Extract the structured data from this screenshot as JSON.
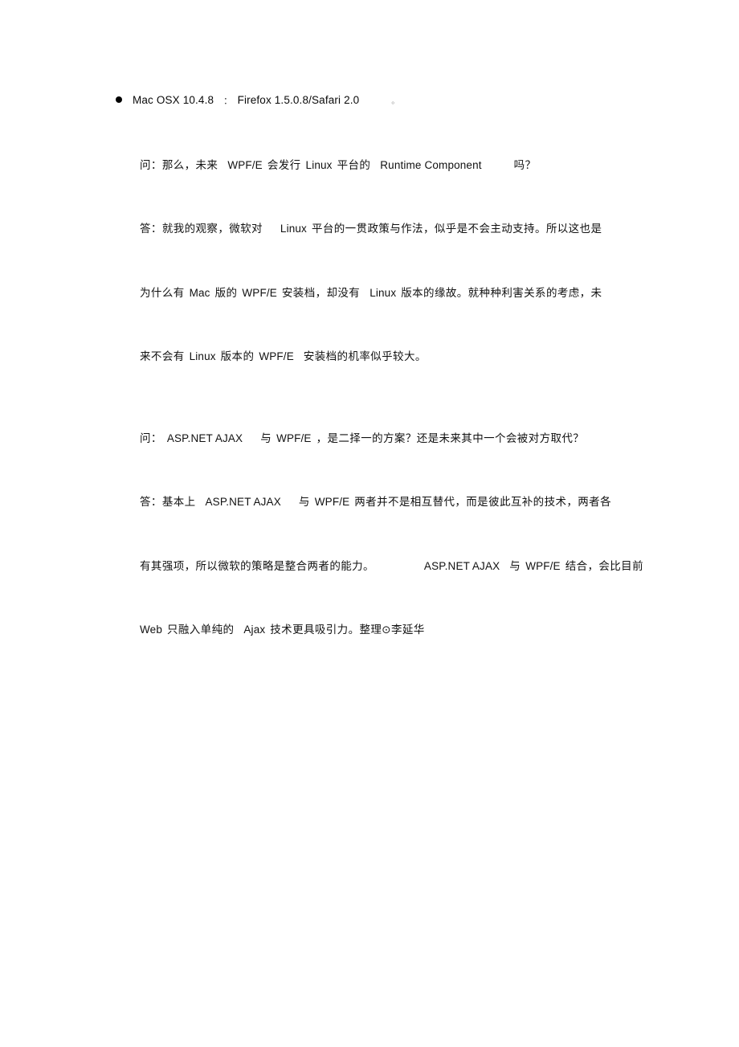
{
  "document": {
    "background_color": "#ffffff",
    "text_color": "#111111",
    "bullet": {
      "marker": "bullet-disc",
      "platform": "Mac OSX 10.4.8",
      "separator": "：",
      "browsers": "Firefox 1.5.0.8/Safari 2.0",
      "trailing_period": "。"
    },
    "qa_blocks": [
      {
        "question": {
          "prefix": "问：",
          "lines": [
            {
              "segments": [
                {
                  "type": "cjk",
                  "text": "问："
                },
                {
                  "type": "cjk",
                  "text": "那么，未来"
                },
                {
                  "type": "gap",
                  "size": "m"
                },
                {
                  "type": "latin",
                  "text": "WPF/E"
                },
                {
                  "type": "gap",
                  "size": "s"
                },
                {
                  "type": "cjk",
                  "text": "会发行"
                },
                {
                  "type": "gap",
                  "size": "s"
                },
                {
                  "type": "latin",
                  "text": "Linux"
                },
                {
                  "type": "gap",
                  "size": "s"
                },
                {
                  "type": "cjk",
                  "text": "平台的"
                },
                {
                  "type": "gap",
                  "size": "m"
                },
                {
                  "type": "latin",
                  "text": "Runtime Component"
                },
                {
                  "type": "gap",
                  "size": "xl"
                },
                {
                  "type": "cjk",
                  "text": "吗？"
                }
              ],
              "plain": "问：那么，未来 WPF/E 会发行 Linux 平台的 Runtime Component 吗？"
            }
          ]
        },
        "answer": {
          "prefix": "答：",
          "lines": [
            {
              "segments": [
                {
                  "type": "cjk",
                  "text": "答：就我的观察，微软对"
                },
                {
                  "type": "gap",
                  "size": "l"
                },
                {
                  "type": "latin",
                  "text": "Linux"
                },
                {
                  "type": "gap",
                  "size": "s"
                },
                {
                  "type": "cjk",
                  "text": "平台的一贯政策与作法，似乎是不会主动支持。所以这也是"
                }
              ],
              "plain": "答：就我的观察，微软对 Linux 平台的一贯政策与作法，似乎是不会主动支持。所以这也是"
            },
            {
              "segments": [
                {
                  "type": "cjk",
                  "text": "为什么有"
                },
                {
                  "type": "gap",
                  "size": "s"
                },
                {
                  "type": "latin",
                  "text": "Mac"
                },
                {
                  "type": "gap",
                  "size": "s"
                },
                {
                  "type": "cjk",
                  "text": "版的"
                },
                {
                  "type": "gap",
                  "size": "s"
                },
                {
                  "type": "latin",
                  "text": "WPF/E"
                },
                {
                  "type": "gap",
                  "size": "s"
                },
                {
                  "type": "cjk",
                  "text": "安装档，却没有"
                },
                {
                  "type": "gap",
                  "size": "m"
                },
                {
                  "type": "latin",
                  "text": "Linux"
                },
                {
                  "type": "gap",
                  "size": "s"
                },
                {
                  "type": "cjk",
                  "text": "版本的缘故。就种种利害关系的考虑，未"
                }
              ],
              "plain": "为什么有 Mac 版的 WPF/E 安装档，却没有 Linux 版本的缘故。就种种利害关系的考虑，未"
            },
            {
              "segments": [
                {
                  "type": "cjk",
                  "text": "来不会有"
                },
                {
                  "type": "gap",
                  "size": "s"
                },
                {
                  "type": "latin",
                  "text": "Linux"
                },
                {
                  "type": "gap",
                  "size": "s"
                },
                {
                  "type": "cjk",
                  "text": "版本的"
                },
                {
                  "type": "gap",
                  "size": "s"
                },
                {
                  "type": "latin",
                  "text": "WPF/E"
                },
                {
                  "type": "gap",
                  "size": "m"
                },
                {
                  "type": "cjk",
                  "text": "安装档的机率似乎较大。"
                }
              ],
              "plain": "来不会有 Linux 版本的 WPF/E 安装档的机率似乎较大。"
            }
          ]
        }
      },
      {
        "question": {
          "prefix": "问：",
          "lines": [
            {
              "segments": [
                {
                  "type": "cjk",
                  "text": "问："
                },
                {
                  "type": "gap",
                  "size": "s"
                },
                {
                  "type": "latin",
                  "text": "ASP.NET AJAX"
                },
                {
                  "type": "gap",
                  "size": "l"
                },
                {
                  "type": "cjk",
                  "text": "与"
                },
                {
                  "type": "gap",
                  "size": "s"
                },
                {
                  "type": "latin",
                  "text": "WPF/E"
                },
                {
                  "type": "gap",
                  "size": "s"
                },
                {
                  "type": "cjk",
                  "text": "，是二择一的方案？还是未来其中一个会被对方取代？"
                }
              ],
              "plain": "问： ASP.NET AJAX 与 WPF/E ，是二择一的方案？还是未来其中一个会被对方取代？"
            }
          ]
        },
        "answer": {
          "prefix": "答：",
          "lines": [
            {
              "segments": [
                {
                  "type": "cjk",
                  "text": "答：基本上"
                },
                {
                  "type": "gap",
                  "size": "m"
                },
                {
                  "type": "latin",
                  "text": "ASP.NET AJAX"
                },
                {
                  "type": "gap",
                  "size": "l"
                },
                {
                  "type": "cjk",
                  "text": "与"
                },
                {
                  "type": "gap",
                  "size": "s"
                },
                {
                  "type": "latin",
                  "text": "WPF/E"
                },
                {
                  "type": "gap",
                  "size": "s"
                },
                {
                  "type": "cjk",
                  "text": "两者并不是相互替代，而是彼此互补的技术，两者各"
                }
              ],
              "plain": "答：基本上 ASP.NET AJAX 与 WPF/E 两者并不是相互替代，而是彼此互补的技术，两者各"
            },
            {
              "segments": [
                {
                  "type": "cjk",
                  "text": "有其强项，所以微软的策略是整合两者的能力。"
                },
                {
                  "type": "gap",
                  "size": "xxl"
                },
                {
                  "type": "latin",
                  "text": "ASP.NET AJAX"
                },
                {
                  "type": "gap",
                  "size": "m"
                },
                {
                  "type": "cjk",
                  "text": "与"
                },
                {
                  "type": "gap",
                  "size": "s"
                },
                {
                  "type": "latin",
                  "text": "WPF/E"
                },
                {
                  "type": "gap",
                  "size": "s"
                },
                {
                  "type": "cjk",
                  "text": "结合，会比目前"
                }
              ],
              "plain": "有其强项，所以微软的策略是整合两者的能力。 ASP.NET AJAX 与 WPF/E 结合，会比目前"
            },
            {
              "segments": [
                {
                  "type": "latin",
                  "text": "Web"
                },
                {
                  "type": "gap",
                  "size": "s"
                },
                {
                  "type": "cjk",
                  "text": "只融入单纯的"
                },
                {
                  "type": "gap",
                  "size": "m"
                },
                {
                  "type": "latin",
                  "text": "Ajax"
                },
                {
                  "type": "gap",
                  "size": "s"
                },
                {
                  "type": "cjk",
                  "text": "技术更具吸引力。整理⊙李延华"
                }
              ],
              "plain": "Web 只融入单纯的 Ajax 技术更具吸引力。整理⊙李延华"
            }
          ]
        }
      }
    ]
  }
}
